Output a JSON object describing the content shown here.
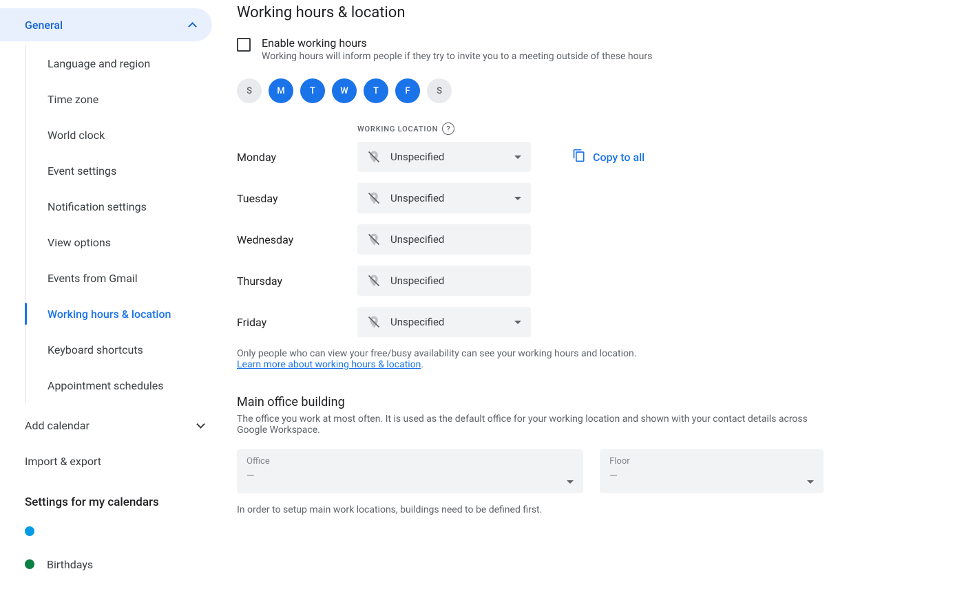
{
  "sidebar": {
    "general_label": "General",
    "items": [
      "Language and region",
      "Time zone",
      "World clock",
      "Event settings",
      "Notification settings",
      "View options",
      "Events from Gmail",
      "Working hours & location",
      "Keyboard shortcuts",
      "Appointment schedules"
    ],
    "add_calendar": "Add calendar",
    "import_export": "Import & export",
    "settings_for_my_calendars": "Settings for my calendars",
    "calendars": [
      {
        "name": "",
        "color": "#039be5"
      },
      {
        "name": "Birthdays",
        "color": "#0b8043"
      }
    ]
  },
  "main": {
    "heading": "Working hours & location",
    "enable_title": "Enable working hours",
    "enable_sub": "Working hours will inform people if they try to invite you to a meeting outside of these hours",
    "days": [
      {
        "letter": "S",
        "active": false
      },
      {
        "letter": "M",
        "active": true
      },
      {
        "letter": "T",
        "active": true
      },
      {
        "letter": "W",
        "active": true
      },
      {
        "letter": "T",
        "active": true
      },
      {
        "letter": "F",
        "active": true
      },
      {
        "letter": "S",
        "active": false
      }
    ],
    "working_location_header": "WORKING LOCATION",
    "copy_to_all": "Copy to all",
    "day_rows": [
      {
        "day": "Monday",
        "location": "Unspecified"
      },
      {
        "day": "Tuesday",
        "location": "Unspecified"
      },
      {
        "day": "Wednesday",
        "location": "Unspecified"
      },
      {
        "day": "Thursday",
        "location": "Unspecified"
      },
      {
        "day": "Friday",
        "location": "Unspecified"
      }
    ],
    "info_text": "Only people who can view your free/busy availability can see your working hours and location.",
    "info_link": "Learn more about working hours & location",
    "main_office_heading": "Main office building",
    "main_office_desc": "The office you work at most often. It is used as the default office for your working location and shown with your contact details across Google Workspace.",
    "office_label": "Office",
    "office_value": "—",
    "floor_label": "Floor",
    "floor_value": "—",
    "setup_note": "In order to setup main work locations, buildings need to be defined first."
  }
}
